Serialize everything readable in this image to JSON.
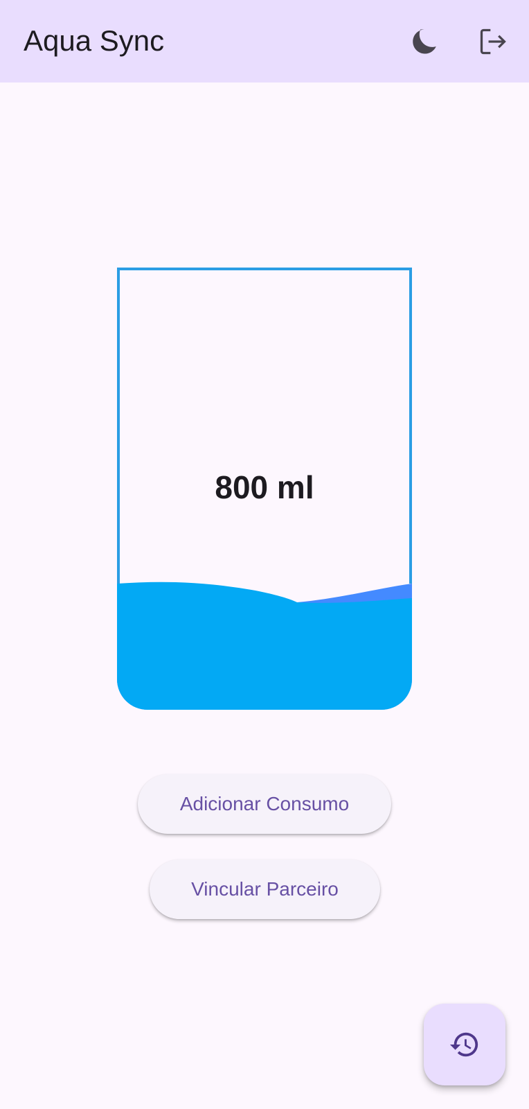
{
  "app_bar": {
    "title": "Aqua Sync",
    "theme_icon": "dark-mode-moon-icon",
    "logout_icon": "logout-icon"
  },
  "water_glass": {
    "amount_label": "800 ml",
    "colors": {
      "outline": "#2b9de4",
      "water": "#03a9f4",
      "back_wave": "#448aff",
      "background": "#fdf7fe"
    }
  },
  "actions": {
    "add_consumption_label": "Adicionar Consumo",
    "link_partner_label": "Vincular Parceiro"
  },
  "fab": {
    "icon": "history-icon"
  },
  "theme": {
    "app_bar_color": "#e9ddfe",
    "button_text_color": "#6750a4",
    "button_bg_color": "#f6f2fa"
  }
}
